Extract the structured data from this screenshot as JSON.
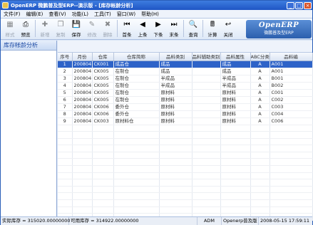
{
  "window": {
    "title": "OpenERP 微鹏普及型ERP--演示版 - [库存帐龄分析]",
    "min": "_",
    "max": "□",
    "close": "×"
  },
  "menu": [
    "文件(F)",
    "编辑(E)",
    "查看(V)",
    "功能(L)",
    "工具(T)",
    "窗口(W)",
    "帮助(H)"
  ],
  "toolbar": [
    {
      "label": "样式",
      "icon": "style-icon",
      "glyph": "▦",
      "enabled": false
    },
    {
      "label": "预览",
      "icon": "preview-icon",
      "glyph": "⎙",
      "enabled": true
    },
    {
      "sep": true
    },
    {
      "label": "新增",
      "icon": "new-icon",
      "glyph": "✚",
      "enabled": false
    },
    {
      "label": "复制",
      "icon": "copy-icon",
      "glyph": "❐",
      "enabled": false
    },
    {
      "label": "保存",
      "icon": "save-icon",
      "glyph": "💾",
      "enabled": true
    },
    {
      "label": "修改",
      "icon": "edit-icon",
      "glyph": "✎",
      "enabled": false
    },
    {
      "label": "删除",
      "icon": "delete-icon",
      "glyph": "✖",
      "enabled": false
    },
    {
      "sep": true
    },
    {
      "label": "首条",
      "icon": "first-icon",
      "glyph": "⏮",
      "enabled": true
    },
    {
      "label": "上条",
      "icon": "prev-icon",
      "glyph": "◀",
      "enabled": true
    },
    {
      "label": "下条",
      "icon": "next-icon",
      "glyph": "▶",
      "enabled": true
    },
    {
      "label": "末条",
      "icon": "last-icon",
      "glyph": "⏭",
      "enabled": true
    },
    {
      "sep": true
    },
    {
      "label": "查询",
      "icon": "search-icon",
      "glyph": "🔍",
      "enabled": true
    },
    {
      "sep": true
    },
    {
      "label": "计算",
      "icon": "calculator-icon",
      "glyph": "🖩",
      "enabled": true
    },
    {
      "label": "关闭",
      "icon": "close-arrow-icon",
      "glyph": "↩",
      "enabled": true
    }
  ],
  "logo": {
    "line1": "OpenERP",
    "line2": "微鹏普及型ERP"
  },
  "left_panel": {
    "title": "库存帐龄分析"
  },
  "table": {
    "columns": [
      "序号",
      "月份",
      "仓库",
      "仓库简称",
      "品料类别",
      "品料辅助类别",
      "品料属性",
      "ABC分类",
      "品料编"
    ],
    "rows": [
      [
        "1",
        "200804",
        "CK001",
        "成品仓",
        "成品",
        "",
        "成品",
        "A",
        "A001"
      ],
      [
        "2",
        "200804",
        "CK005",
        "在制仓",
        "成品",
        "",
        "成品",
        "A",
        "A001"
      ],
      [
        "3",
        "200804",
        "CK005",
        "在制仓",
        "半成品",
        "",
        "半成品",
        "A",
        "B001"
      ],
      [
        "4",
        "200804",
        "CK005",
        "在制仓",
        "半成品",
        "",
        "半成品",
        "A",
        "B002"
      ],
      [
        "5",
        "200804",
        "CK005",
        "在制仓",
        "原材料",
        "",
        "原材料",
        "A",
        "C001"
      ],
      [
        "6",
        "200804",
        "CK005",
        "在制仓",
        "原材料",
        "",
        "原材料",
        "A",
        "C002"
      ],
      [
        "7",
        "200804",
        "CK006",
        "委外仓",
        "原材料",
        "",
        "原材料",
        "A",
        "C003"
      ],
      [
        "8",
        "200804",
        "CK006",
        "委外仓",
        "原材料",
        "",
        "原材料",
        "A",
        "C004"
      ],
      [
        "9",
        "200804",
        "CK003",
        "原材料仓",
        "原材料",
        "",
        "原材料",
        "A",
        "C006"
      ]
    ],
    "selected_row": 0
  },
  "status": {
    "stock": "实际库存 = 315020.00000000",
    "available": "可用库存 = 314922.00000000",
    "user": "ADM",
    "edition": "Openerp普及版",
    "datetime": "2008-05-15 17:59:11"
  }
}
